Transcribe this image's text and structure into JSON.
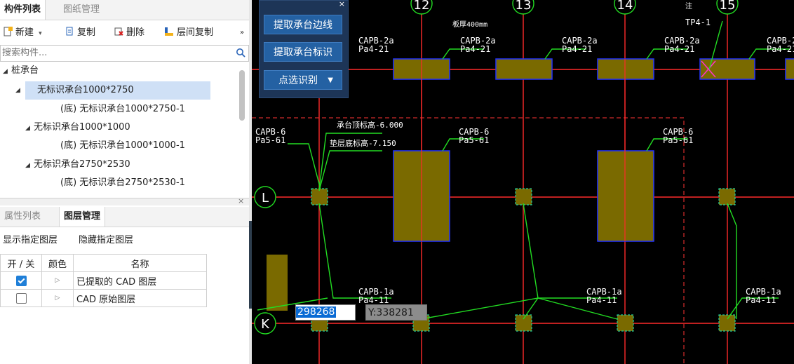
{
  "left_panel": {
    "tabs": [
      "构件列表",
      "图纸管理"
    ],
    "toolbar": {
      "new_label": "新建",
      "copy_label": "复制",
      "delete_label": "删除",
      "floor_copy_label": "层间复制",
      "more_label": "»"
    },
    "search": {
      "placeholder": "搜索构件..."
    },
    "tree": {
      "root": "桩承台",
      "groups": [
        {
          "name": "无标识承台1000*2750",
          "child": "(底) 无标识承台1000*2750-1"
        },
        {
          "name": "无标识承台1000*1000",
          "child": "(底) 无标识承台1000*1000-1"
        },
        {
          "name": "无标识承台2750*2530",
          "child": "(底) 无标识承台2750*2530-1"
        }
      ]
    },
    "lower_tabs": [
      "属性列表",
      "图层管理"
    ],
    "close_label": "×",
    "layer_actions": [
      "显示指定图层",
      "隐藏指定图层"
    ],
    "layer_table": {
      "headers": [
        "开 / 关",
        "颜色",
        "名称"
      ],
      "rows": [
        {
          "checked": true,
          "name": "已提取的 CAD 图层"
        },
        {
          "checked": false,
          "name": "CAD 原始图层"
        }
      ]
    }
  },
  "float_panel": {
    "buttons": [
      "提取承台边线",
      "提取承台标识",
      "点选识别"
    ],
    "close_label": "×"
  },
  "cad": {
    "axis_numbers": [
      "12",
      "13",
      "14",
      "15"
    ],
    "axis_letters": [
      "L",
      "K"
    ],
    "labels": {
      "capb2a": "CAPB-2a",
      "pa421": "Pa4-21",
      "capb6": "CAPB-6",
      "pa561": "Pa5-61",
      "capb1a": "CAPB-1a",
      "pa411": "Pa4-11",
      "tp41": "TP4-1",
      "elev1": "承台顶标高-6.000",
      "elev2": "垫层底标高-7.150",
      "note400": "板厚400mm",
      "marker": "注"
    },
    "colors": {
      "grid": "#ff2a2a",
      "leader": "#22dd22",
      "cap_fill": "#7a6a00",
      "cap_border": "#2233ff",
      "text": "#ffffff"
    }
  },
  "coords": {
    "x": "298268",
    "y": "Y:338281"
  }
}
